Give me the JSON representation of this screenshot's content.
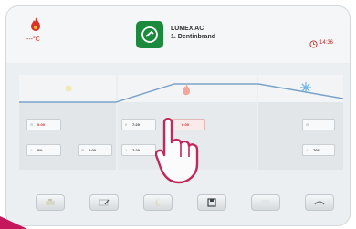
{
  "header": {
    "temperature": "---°C",
    "program_line1": "LUMEX AC",
    "program_line2": "1. Dentinbrand",
    "time": "14:36"
  },
  "colors": {
    "flame": "#d9322a",
    "mode_icon": "#1c8a3c",
    "accent_corner": "#c5185c",
    "snow": "#6fb4e4"
  },
  "left_panel": {
    "cells": [
      {
        "label": "⊙",
        "value": "0:00"
      },
      {
        "label": "↕",
        "value": "0%"
      }
    ],
    "side": {
      "label": "⊖",
      "value": "0:00"
    }
  },
  "center_panel": {
    "cells": [
      {
        "label": "//",
        "value": "7:20"
      },
      {
        "label": "↕",
        "value": "7:20"
      }
    ],
    "highlight": {
      "label": "",
      "value": "0:00"
    },
    "side": {
      "label": "⊖",
      "value": ""
    }
  },
  "right_panel": {
    "cells": [
      {
        "label": "⊙",
        "value": ""
      },
      {
        "label": "↕",
        "value": "70%"
      }
    ]
  },
  "toolbar": [
    "temp-button",
    "edit-button",
    "night-button",
    "save-button",
    "blank-button",
    "lift-button"
  ]
}
